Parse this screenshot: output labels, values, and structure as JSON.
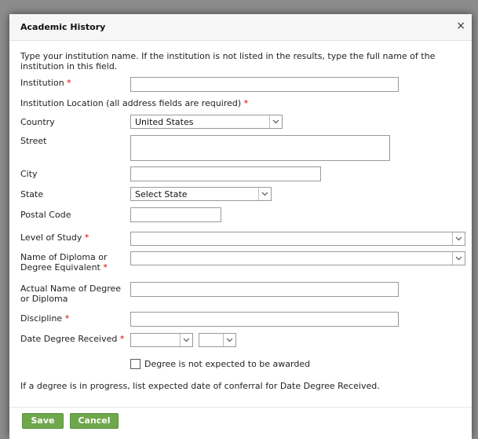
{
  "dialog": {
    "title": "Academic History",
    "close_glyph": "×",
    "intro": "Type your institution name. If the institution is not listed in the results, type the full name of the institution in this field."
  },
  "fields": {
    "institution_label": "Institution",
    "location_label": "Institution Location (all address fields are required)",
    "country_label": "Country",
    "country_value": "United States",
    "street_label": "Street",
    "city_label": "City",
    "state_label": "State",
    "state_value": "Select State",
    "postal_label": "Postal Code",
    "level_label": "Level of Study",
    "diploma_label_1": "Name of Diploma or",
    "diploma_label_2": "Degree Equivalent",
    "actual_label_1": "Actual Name of Degree",
    "actual_label_2": "or Diploma",
    "discipline_label": "Discipline",
    "date_label": "Date Degree Received",
    "required_mark": "*",
    "not_expected_label": "Degree is not expected to be awarded",
    "in_progress_note": "If a degree is in progress, list expected date of conferral for Date Degree Received."
  },
  "footer": {
    "save_label": "Save",
    "cancel_label": "Cancel"
  },
  "colors": {
    "required": "#e00000",
    "button_green": "#6fa74c"
  }
}
